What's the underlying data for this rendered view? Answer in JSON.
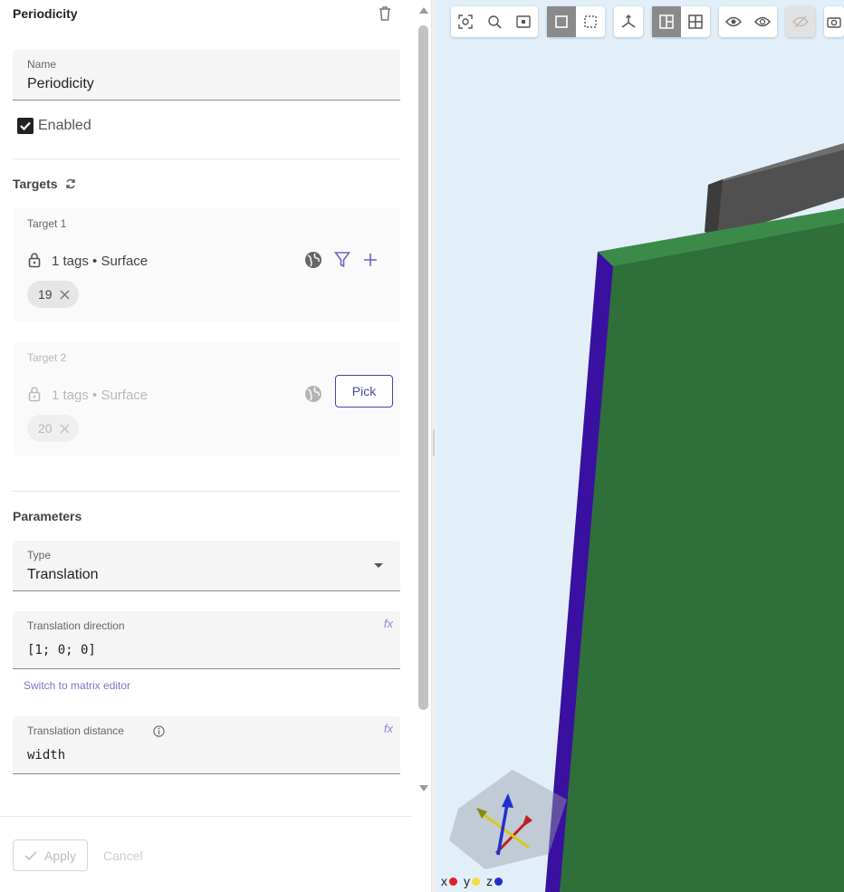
{
  "panel": {
    "title": "Periodicity",
    "name_field": {
      "label": "Name",
      "value": "Periodicity"
    },
    "enabled": {
      "label": "Enabled",
      "checked": true
    },
    "targets": {
      "heading": "Targets",
      "target1": {
        "label": "Target 1",
        "tags": "1 tags • Surface",
        "chip": "19"
      },
      "target2": {
        "label": "Target 2",
        "tags": "1 tags • Surface",
        "chip": "20",
        "pick_label": "Pick"
      }
    },
    "parameters": {
      "heading": "Parameters",
      "type": {
        "label": "Type",
        "value": "Translation"
      },
      "direction": {
        "label": "Translation direction",
        "value": "[1; 0; 0]",
        "fx": "fx"
      },
      "switch_link": "Switch to matrix editor",
      "distance": {
        "label": "Translation distance",
        "value": "width",
        "fx": "fx"
      }
    },
    "footer": {
      "apply": "Apply",
      "cancel": "Cancel"
    }
  },
  "viewport": {
    "axes": [
      "x",
      "y",
      "z"
    ],
    "colors": {
      "x": "#e02020",
      "y": "#f0e040",
      "z": "#2030d0",
      "face": "#2f6f3a",
      "edge": "#3a10a0",
      "block": "#505050",
      "background": "#e2eff9",
      "accent": "#4a45a8"
    }
  }
}
